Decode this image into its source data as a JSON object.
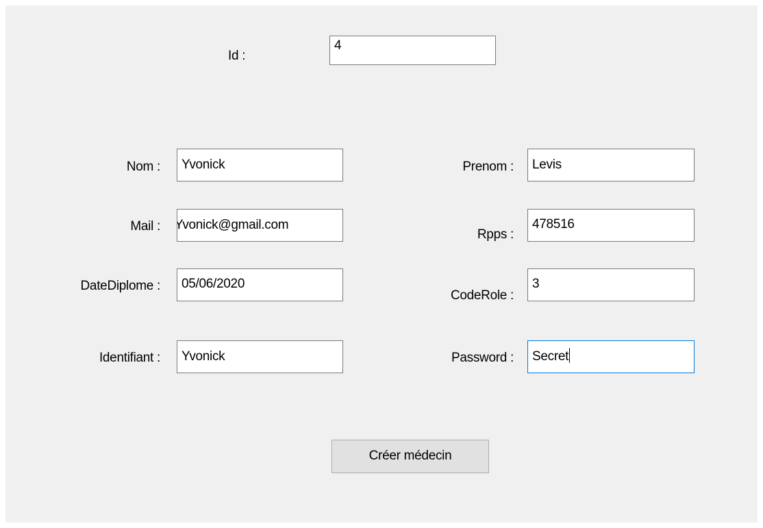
{
  "form": {
    "id": {
      "label": "Id :",
      "value": "4"
    },
    "nom": {
      "label": "Nom :",
      "value": "Yvonick"
    },
    "prenom": {
      "label": "Prenom :",
      "value": "Levis"
    },
    "mail": {
      "label": "Mail :",
      "value": "Yvonick@gmail.com"
    },
    "rpps": {
      "label": "Rpps :",
      "value": "478516"
    },
    "date_diplome": {
      "label": "DateDiplome :",
      "value": "05/06/2020"
    },
    "code_role": {
      "label": "CodeRole :",
      "value": "3"
    },
    "identifiant": {
      "label": "Identifiant :",
      "value": "Yvonick"
    },
    "password": {
      "label": "Password :",
      "value": "Secret"
    },
    "submit_label": "Créer médecin"
  },
  "colors": {
    "panel_bg": "#f0f0f0",
    "field_border": "#7a7a7a",
    "focus_border": "#0078d7",
    "button_bg": "#e1e1e1"
  }
}
